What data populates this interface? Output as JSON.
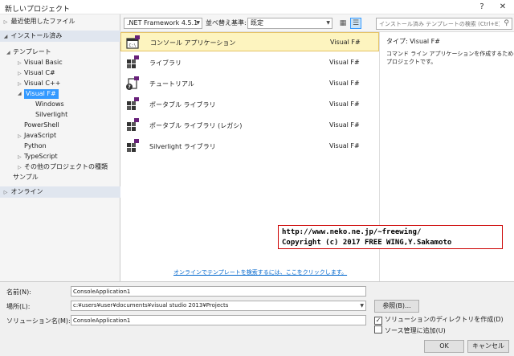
{
  "window": {
    "title": "新しいプロジェクト",
    "help_label": "?",
    "close_label": "✕"
  },
  "left_pane": {
    "recent": "最近使用したファイル",
    "installed": "インストール済み",
    "templates_label": "テンプレート",
    "tree": [
      {
        "label": "Visual Basic",
        "arrow": "▷"
      },
      {
        "label": "Visual C#",
        "arrow": "▷"
      },
      {
        "label": "Visual C++",
        "arrow": "▷"
      },
      {
        "label": "Visual F#",
        "arrow": "◢"
      },
      {
        "label": "Windows",
        "arrow": ""
      },
      {
        "label": "Silverlight",
        "arrow": ""
      },
      {
        "label": "PowerShell",
        "arrow": ""
      },
      {
        "label": "JavaScript",
        "arrow": "▷"
      },
      {
        "label": "Python",
        "arrow": ""
      },
      {
        "label": "TypeScript",
        "arrow": "▷"
      },
      {
        "label": "その他のプロジェクトの種類",
        "arrow": "▷"
      },
      {
        "label": "サンプル",
        "arrow": ""
      }
    ],
    "online": "オンライン"
  },
  "toolbar": {
    "framework": ".NET Framework 4.5.1",
    "sort_label": "並べ替え基準:",
    "sort_value": "既定",
    "search_placeholder": "インストール済み テンプレートの検索 (Ctrl+E)"
  },
  "templates": [
    {
      "name": "コンソール アプリケーション",
      "lang": "Visual F#"
    },
    {
      "name": "ライブラリ",
      "lang": "Visual F#"
    },
    {
      "name": "チュートリアル",
      "lang": "Visual F#"
    },
    {
      "name": "ポータブル ライブラリ",
      "lang": "Visual F#"
    },
    {
      "name": "ポータブル ライブラリ (レガシ)",
      "lang": "Visual F#"
    },
    {
      "name": "Silverlight ライブラリ",
      "lang": "Visual F#"
    }
  ],
  "online_link": "オンラインでテンプレートを検索するには、ここをクリックします。",
  "details": {
    "type_label": "タイプ:",
    "type_value": "Visual F#",
    "desc_line1": "コマンド ライン アプリケーションを作成するための",
    "desc_line2": "プロジェクトです。"
  },
  "watermark": {
    "line1": "http://www.neko.ne.jp/~freewing/",
    "line2": "Copyright (c) 2017 FREE WING,Y.Sakamoto"
  },
  "form": {
    "name_label": "名前(N):",
    "name_value": "ConsoleApplication1",
    "location_label": "場所(L):",
    "location_value": "c:¥users¥user¥documents¥visual studio 2013¥Projects",
    "solution_label": "ソリューション名(M):",
    "solution_value": "ConsoleApplication1",
    "browse_label": "参照(B)...",
    "create_dir_label": "ソリューションのディレクトリを作成(D)",
    "source_control_label": "ソース管理に追加(U)",
    "ok_label": "OK",
    "cancel_label": "キャンセル"
  },
  "colors": {
    "selection": "#3399ff",
    "selected_row": "#fdf4bf",
    "link": "#0066cc",
    "watermark_border": "#cc0000"
  }
}
